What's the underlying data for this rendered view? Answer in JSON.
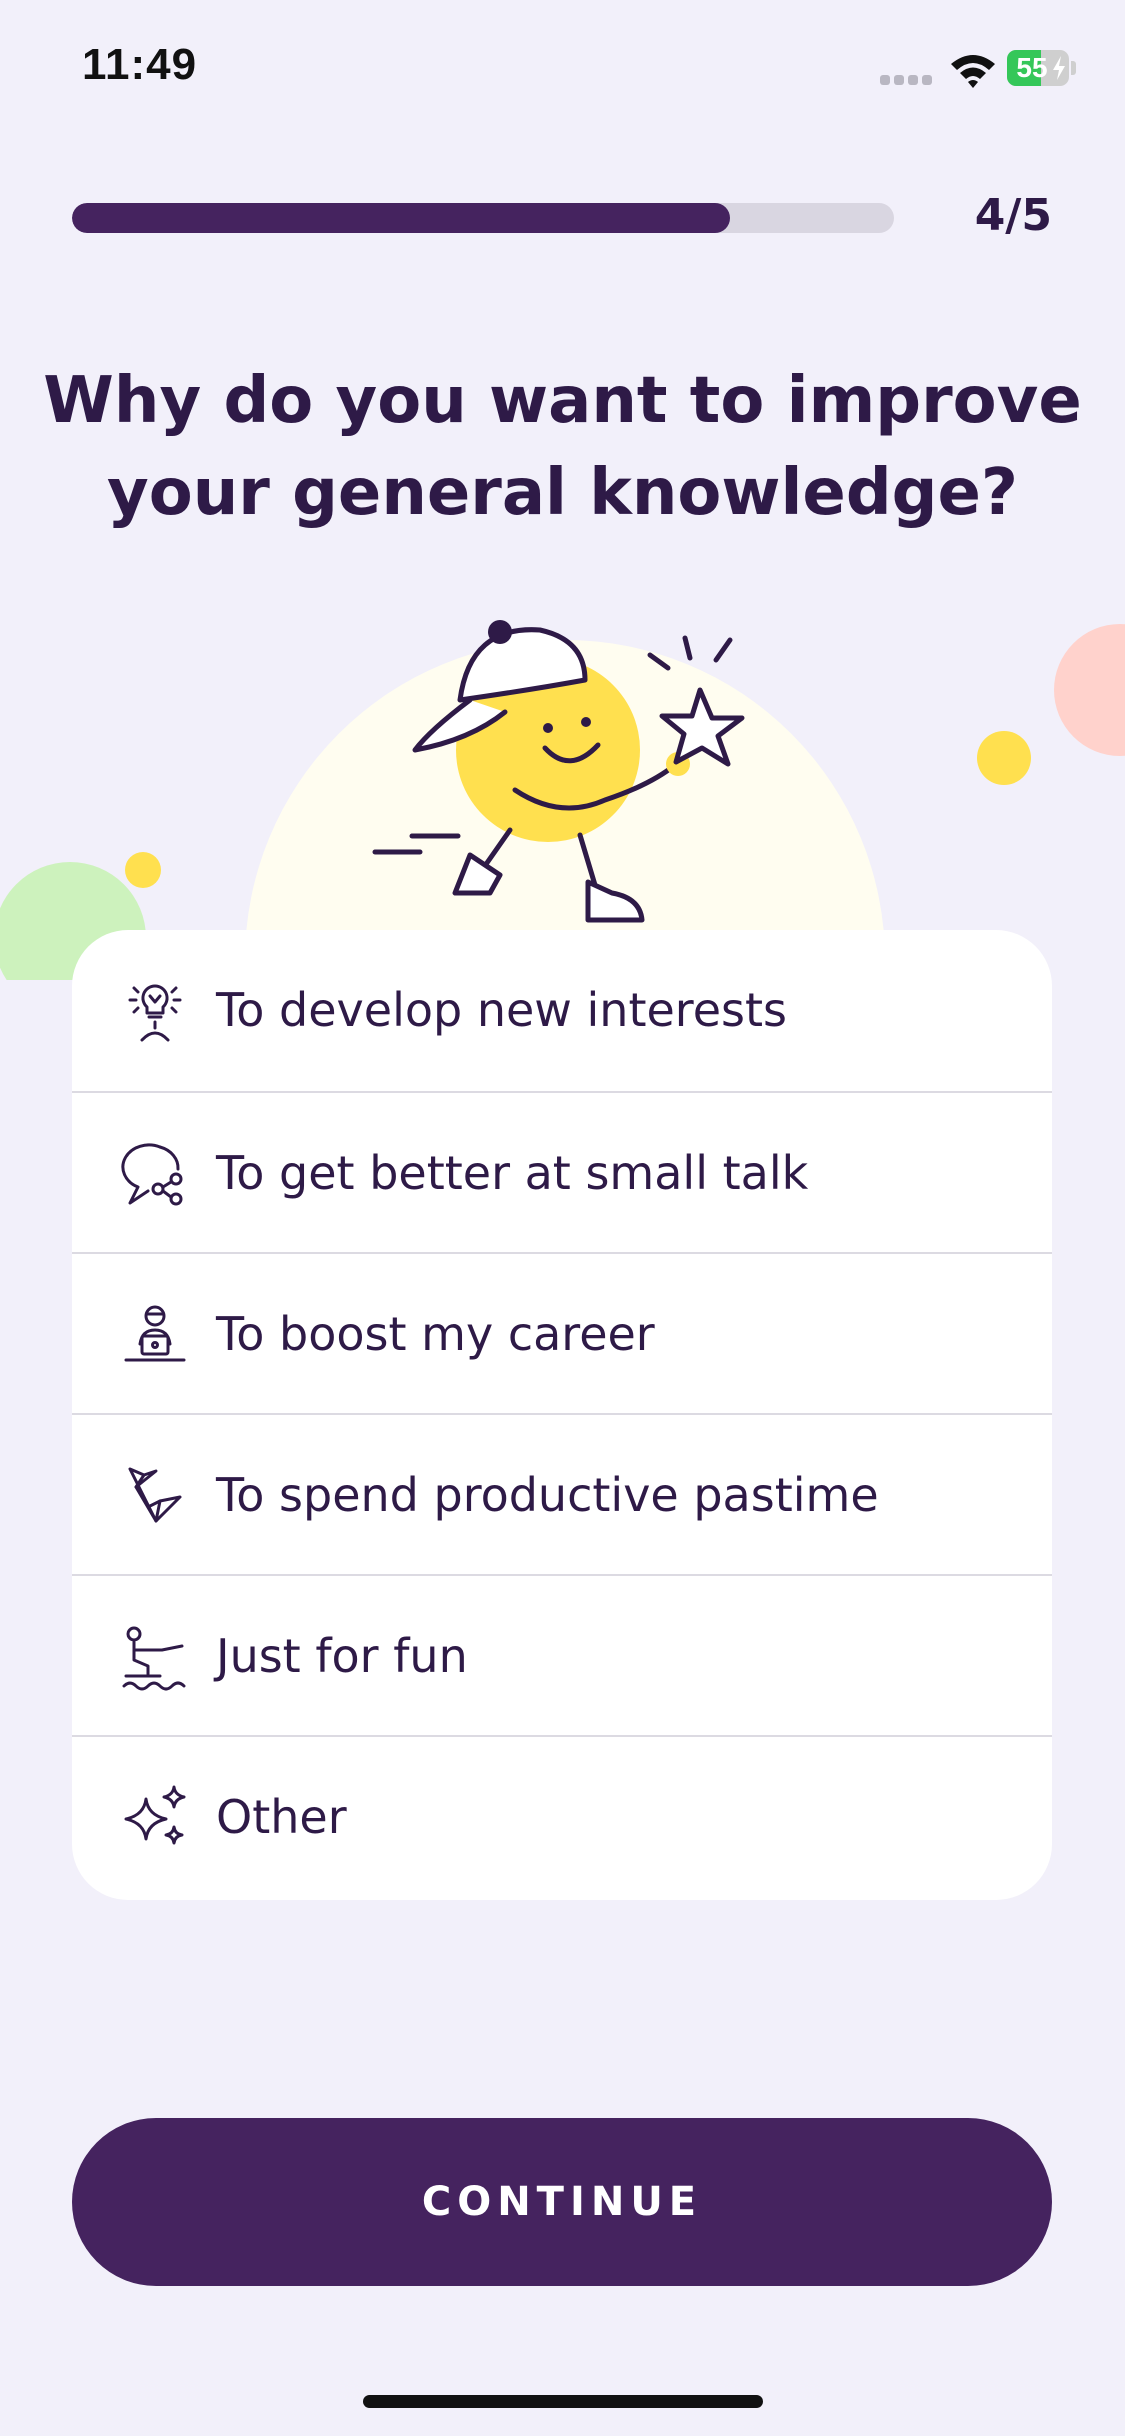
{
  "status_bar": {
    "time": "11:49",
    "battery": "55",
    "battery_level": 0.55
  },
  "progress": {
    "label": "4/5",
    "step": 4,
    "total": 5,
    "fraction": 0.8
  },
  "question": {
    "line1": "Why do you want to improve",
    "line2": "your general knowledge?"
  },
  "options": [
    {
      "label": "To develop new interests",
      "icon": "lightbulb-person-icon"
    },
    {
      "label": "To get better at small talk",
      "icon": "chat-share-icon"
    },
    {
      "label": "To boost my career",
      "icon": "person-laptop-icon"
    },
    {
      "label": "To spend productive pastime",
      "icon": "origami-bird-icon"
    },
    {
      "label": "Just for fun",
      "icon": "wakeboard-icon"
    },
    {
      "label": "Other",
      "icon": "sparkles-icon"
    }
  ],
  "continue_button": {
    "label": "CONTINUE"
  },
  "colors": {
    "background": "#f2f0fa",
    "primary": "#45235f",
    "text": "#2e1a47",
    "mascot_yellow": "#ffe04f",
    "bubble_green": "#cdf2bd",
    "bubble_pink": "#ffd2cc"
  }
}
